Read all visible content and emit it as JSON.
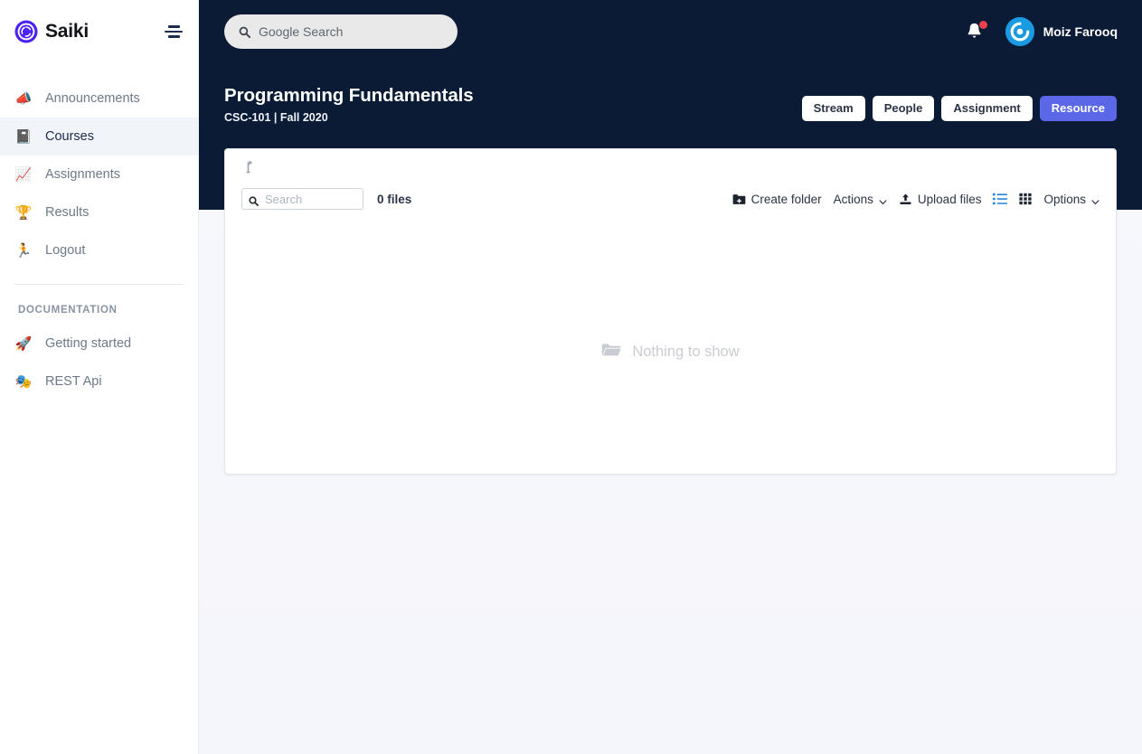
{
  "brand": {
    "name": "Saiki",
    "logo_icon": "aperture-logo-icon",
    "menu_icon": "hamburger-icon"
  },
  "sidebar": {
    "items": [
      {
        "label": "Announcements",
        "icon": "megaphone-icon",
        "glyph": "📣",
        "active": false
      },
      {
        "label": "Courses",
        "icon": "notebook-icon",
        "glyph": "📓",
        "active": true
      },
      {
        "label": "Assignments",
        "icon": "activity-icon",
        "glyph": "📈",
        "active": false
      },
      {
        "label": "Results",
        "icon": "trophy-icon",
        "glyph": "🏆",
        "active": false
      },
      {
        "label": "Logout",
        "icon": "runner-icon",
        "glyph": "🏃",
        "active": false
      }
    ],
    "section_title": "DOCUMENTATION",
    "doc_items": [
      {
        "label": "Getting started",
        "icon": "rocket-icon",
        "glyph": "🚀"
      },
      {
        "label": "REST Api",
        "icon": "masks-icon",
        "glyph": "🎭"
      }
    ]
  },
  "topbar": {
    "search": {
      "placeholder": "Google Search",
      "value": "",
      "icon": "search-icon"
    },
    "notification": {
      "icon": "bell-icon",
      "has_badge": true,
      "badge_color": "#f1404b"
    },
    "user": {
      "name": "Moiz Farooq",
      "avatar_icon": "gravatar-avatar-icon",
      "avatar_color": "#1a9ae0"
    }
  },
  "course": {
    "title": "Programming Fundamentals",
    "subtitle": "CSC-101 | Fall 2020",
    "tabs": [
      {
        "label": "Stream",
        "active": false
      },
      {
        "label": "People",
        "active": false
      },
      {
        "label": "Assignment",
        "active": false
      },
      {
        "label": "Resource",
        "active": true
      }
    ],
    "active_tab_color": "#5a68e8"
  },
  "file_manager": {
    "levelup_icon": "level-up-arrow-icon",
    "search": {
      "placeholder": "Search",
      "value": "",
      "icon": "search-icon"
    },
    "file_count": "0 files",
    "actions": [
      {
        "label": "Create folder",
        "icon": "folder-plus-icon",
        "has_caret": false
      },
      {
        "label": "Actions",
        "icon": "",
        "has_caret": true
      },
      {
        "label": "Upload files",
        "icon": "upload-icon",
        "has_caret": false
      },
      {
        "label": "Options",
        "icon": "",
        "has_caret": true
      }
    ],
    "view_list_icon": "list-view-icon",
    "view_grid_icon": "grid-view-icon",
    "view_active": "list",
    "view_active_color": "#2483e0",
    "empty_text": "Nothing to show",
    "empty_icon": "folder-icon"
  }
}
